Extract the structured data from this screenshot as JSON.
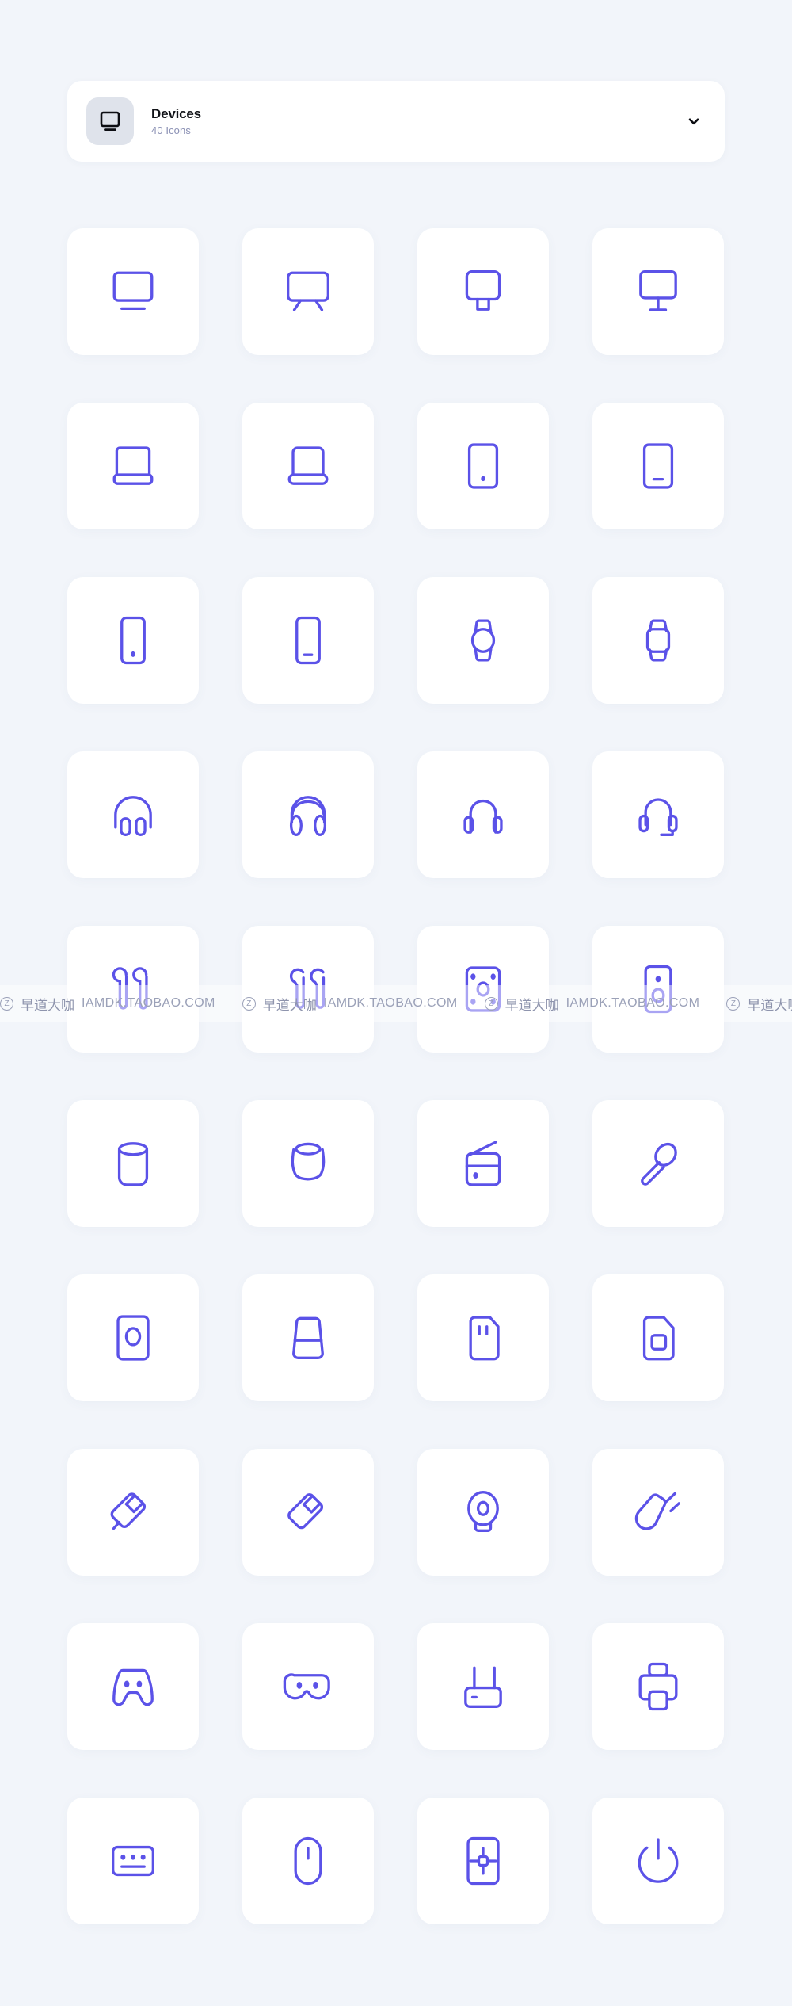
{
  "theme": {
    "page_background": "#F2F5FA",
    "card_background": "#FFFFFF",
    "icon_color": "#5B52E8",
    "header_icon_box": "#DFE3EB",
    "title_color": "#111318",
    "subtitle_color": "#8A90B4"
  },
  "header": {
    "title": "Devices",
    "subtitle": "40 Icons",
    "icon_name": "monitor-icon",
    "chevron_icon": "chevron-down-icon"
  },
  "watermark": {
    "text_cn": "早道大咖",
    "text_en": "IAMDK.TAOBAO.COM",
    "badge": "Z"
  },
  "icons": [
    {
      "id": "monitor",
      "label": "Monitor"
    },
    {
      "id": "tv",
      "label": "TV"
    },
    {
      "id": "monitor-stand",
      "label": "Monitor with stand"
    },
    {
      "id": "monitor-pole-stand",
      "label": "Monitor with pole stand"
    },
    {
      "id": "laptop",
      "label": "Laptop"
    },
    {
      "id": "laptop-rounded",
      "label": "Laptop rounded"
    },
    {
      "id": "tablet-dot",
      "label": "Tablet with home dot"
    },
    {
      "id": "tablet-bar",
      "label": "Tablet with home bar"
    },
    {
      "id": "phone-dot",
      "label": "Phone with home dot"
    },
    {
      "id": "phone-bar",
      "label": "Phone with home bar"
    },
    {
      "id": "smartwatch-round",
      "label": "Round smartwatch"
    },
    {
      "id": "smartwatch-square",
      "label": "Square smartwatch"
    },
    {
      "id": "headphones",
      "label": "Headphones"
    },
    {
      "id": "headphones-padded",
      "label": "Padded headphones"
    },
    {
      "id": "headphones-slim",
      "label": "Slim headphones"
    },
    {
      "id": "headset-mic",
      "label": "Headset with microphone"
    },
    {
      "id": "earbuds",
      "label": "Earbuds"
    },
    {
      "id": "earbuds-pro",
      "label": "Earbuds pro"
    },
    {
      "id": "speaker-grid",
      "label": "Speaker panel"
    },
    {
      "id": "speaker-tower",
      "label": "Speaker tower"
    },
    {
      "id": "smart-speaker",
      "label": "Smart speaker"
    },
    {
      "id": "speaker-round",
      "label": "Round speaker"
    },
    {
      "id": "radio",
      "label": "Radio"
    },
    {
      "id": "microphone",
      "label": "Microphone"
    },
    {
      "id": "disk-drive",
      "label": "Disk drive"
    },
    {
      "id": "external-storage",
      "label": "External storage"
    },
    {
      "id": "memory-card",
      "label": "Memory card"
    },
    {
      "id": "sim-card",
      "label": "SIM card"
    },
    {
      "id": "usb-drive",
      "label": "USB flash drive"
    },
    {
      "id": "usb-drive-alt",
      "label": "USB flash drive alt"
    },
    {
      "id": "webcam",
      "label": "Webcam"
    },
    {
      "id": "power-plug",
      "label": "Power plug"
    },
    {
      "id": "gamepad",
      "label": "Gamepad"
    },
    {
      "id": "vr-headset",
      "label": "VR headset"
    },
    {
      "id": "router",
      "label": "Router"
    },
    {
      "id": "printer",
      "label": "Printer"
    },
    {
      "id": "keyboard",
      "label": "Keyboard"
    },
    {
      "id": "mouse",
      "label": "Mouse"
    },
    {
      "id": "processor-chip",
      "label": "Processor chip"
    },
    {
      "id": "power-button",
      "label": "Power button"
    }
  ]
}
